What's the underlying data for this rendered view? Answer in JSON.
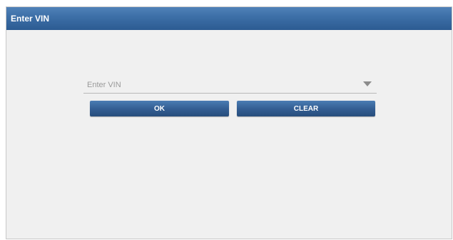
{
  "dialog": {
    "title": "Enter VIN"
  },
  "vin_input": {
    "placeholder": "Enter VIN",
    "value": ""
  },
  "buttons": {
    "ok_label": "OK",
    "clear_label": "CLEAR"
  },
  "colors": {
    "title_bar": "#3c6ea6",
    "button": "#345f94",
    "background": "#f0f0f0"
  },
  "icons": {
    "dropdown": "chevron-down-icon"
  }
}
